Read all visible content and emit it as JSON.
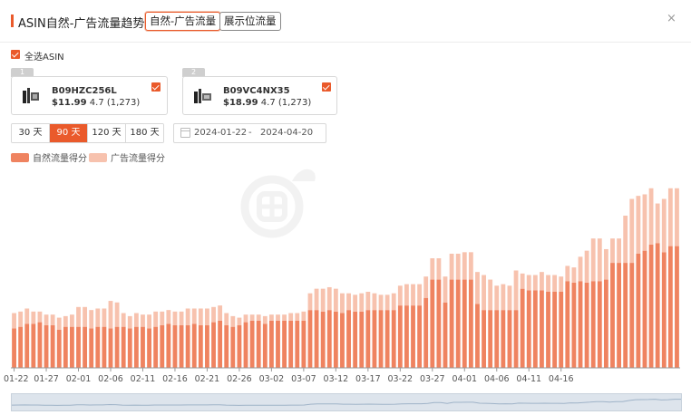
{
  "header": {
    "title": "ASIN自然-广告流量趋势",
    "tabs": [
      {
        "label": "自然-广告流量",
        "active": true
      },
      {
        "label": "展示位流量",
        "active": false
      }
    ],
    "close_icon": "×"
  },
  "select_all": {
    "label": "全选ASIN",
    "checked": true
  },
  "products": [
    {
      "index": "1",
      "asin": "B09HZC256L",
      "price": "$11.99",
      "rating": "4.7",
      "reviews": "(1,273)",
      "checked": true,
      "icon": "product-thumbnail-icon"
    },
    {
      "index": "2",
      "asin": "B09VC4NX35",
      "price": "$18.99",
      "rating": "4.7",
      "reviews": "(1,273)",
      "checked": true,
      "icon": "product-thumbnail-icon"
    }
  ],
  "range_buttons": [
    {
      "label": "30 天",
      "active": false
    },
    {
      "label": "90 天",
      "active": true
    },
    {
      "label": "120 天",
      "active": false
    },
    {
      "label": "180 天",
      "active": false
    }
  ],
  "date_range": {
    "start": "2024-01-22",
    "separator": "-",
    "end": "2024-04-20"
  },
  "colors": {
    "accent": "#ea5a2b",
    "organic": "#ef8360",
    "ad": "#f7c2ae"
  },
  "chart_data": {
    "type": "bar",
    "stacked": true,
    "legend_position": "top-left",
    "grid": false,
    "series": [
      {
        "name": "自然流量得分",
        "values": [
          26,
          27,
          29,
          29,
          30,
          28,
          28,
          25,
          27,
          27,
          27,
          27,
          26,
          27,
          27,
          26,
          27,
          27,
          26,
          27,
          27,
          26,
          27,
          28,
          29,
          28,
          28,
          28,
          29,
          28,
          28,
          30,
          31,
          28,
          27,
          28,
          30,
          31,
          31,
          29,
          31,
          31,
          31,
          31,
          31,
          31,
          38,
          38,
          37,
          38,
          37,
          36,
          38,
          37,
          37,
          38,
          38,
          38,
          38,
          38,
          41,
          41,
          41,
          41,
          46,
          58,
          58,
          43,
          58,
          58,
          58,
          58,
          42,
          38,
          38,
          38,
          38,
          38,
          38,
          52,
          51,
          51,
          51,
          50,
          50,
          50,
          57,
          56,
          57,
          56,
          57,
          57,
          58,
          69,
          69,
          69,
          69,
          75,
          77,
          81,
          82,
          76,
          80,
          80
        ]
      },
      {
        "name": "广告流量得分",
        "values": [
          10,
          10,
          10,
          8,
          7,
          7,
          7,
          8,
          7,
          8,
          13,
          13,
          12,
          12,
          12,
          18,
          16,
          9,
          8,
          9,
          8,
          9,
          10,
          9,
          9,
          9,
          9,
          11,
          10,
          11,
          11,
          10,
          10,
          8,
          7,
          5,
          5,
          4,
          4,
          5,
          4,
          4,
          4,
          5,
          5,
          6,
          11,
          14,
          15,
          15,
          15,
          13,
          11,
          11,
          12,
          12,
          11,
          10,
          10,
          11,
          13,
          14,
          14,
          14,
          14,
          14,
          14,
          17,
          17,
          17,
          18,
          18,
          21,
          23,
          20,
          16,
          17,
          16,
          26,
          10,
          10,
          10,
          12,
          11,
          11,
          10,
          10,
          10,
          16,
          21,
          28,
          28,
          20,
          16,
          16,
          31,
          42,
          38,
          37,
          37,
          26,
          35,
          38,
          38
        ]
      }
    ],
    "x_tick_labels": [
      "01-22",
      "01-27",
      "02-01",
      "02-06",
      "02-11",
      "02-16",
      "02-21",
      "02-26",
      "03-02",
      "03-07",
      "03-12",
      "03-17",
      "03-22",
      "03-27",
      "04-01",
      "04-06",
      "04-11",
      "04-16"
    ],
    "ylim": [
      0,
      125
    ]
  }
}
